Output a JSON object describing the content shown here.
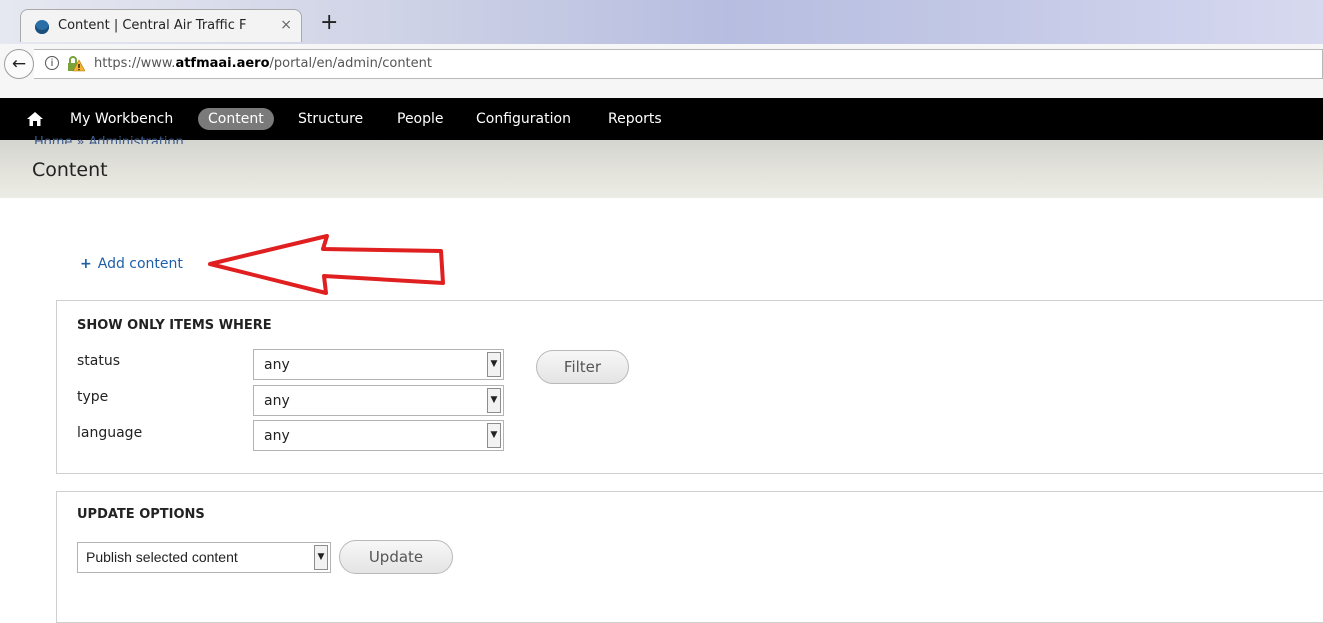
{
  "browser": {
    "tab_title": "Content | Central Air Traffic F",
    "close_glyph": "×",
    "newtab_glyph": "+",
    "back_glyph": "←",
    "info_glyph": "i",
    "url_prefix": "https://www.",
    "url_domain": "atfmaai.aero",
    "url_path": "/portal/en/admin/content"
  },
  "admin_bar": {
    "items": [
      "My Workbench",
      "Content",
      "Structure",
      "People",
      "Configuration",
      "Reports"
    ],
    "active": "Content"
  },
  "page": {
    "breadcrumb": "Home » Administration",
    "title": "Content",
    "add_content_plus": "+",
    "add_content": "Add content"
  },
  "filters": {
    "legend": "SHOW ONLY ITEMS WHERE",
    "fields": [
      {
        "label": "status",
        "value": "any"
      },
      {
        "label": "type",
        "value": "any"
      },
      {
        "label": "language",
        "value": "any"
      }
    ],
    "filter_button": "Filter",
    "dropdown_glyph": "▼"
  },
  "update": {
    "legend": "UPDATE OPTIONS",
    "selected": "Publish selected content",
    "update_button": "Update"
  },
  "colors": {
    "annotation_arrow": "#e02020",
    "link": "#1d5fa8"
  },
  "icons": [
    "drupal-favicon",
    "back-arrow-icon",
    "info-icon",
    "lock-warning-icon",
    "home-icon",
    "plus-icon",
    "red-arrow-annotation"
  ]
}
